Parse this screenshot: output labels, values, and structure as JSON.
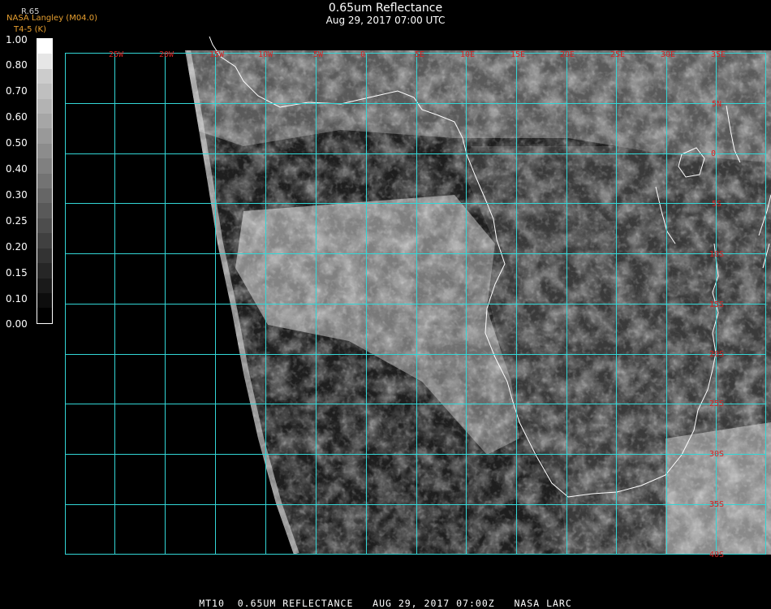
{
  "header": {
    "title": "0.65um Reflectance",
    "subtitle": "Aug 29, 2017 07:00 UTC"
  },
  "colorbar": {
    "top_label": "R.65",
    "agency": "NASA Langley (M04.0)",
    "sub_label": "T4-5 (K)",
    "ticks": [
      "1.00",
      "0.80",
      "0.70",
      "0.60",
      "0.50",
      "0.40",
      "0.30",
      "0.25",
      "0.20",
      "0.15",
      "0.10",
      "0.00"
    ],
    "levels": [
      1.0,
      0.9,
      0.8,
      0.75,
      0.7,
      0.65,
      0.6,
      0.55,
      0.5,
      0.45,
      0.4,
      0.35,
      0.3,
      0.25,
      0.2,
      0.15,
      0.1,
      0.05,
      0.0
    ]
  },
  "map": {
    "longitude_labels": [
      "25W",
      "20W",
      "15W",
      "10W",
      "5W",
      "0",
      "5E",
      "10E",
      "15E",
      "20E",
      "25E",
      "30E",
      "35E"
    ],
    "latitude_labels": [
      "5N",
      "0",
      "5S",
      "10S",
      "15S",
      "20S",
      "25S",
      "30S",
      "35S",
      "40S"
    ],
    "grid_color": "#33d6d6",
    "label_color": "#d62222",
    "coast_color": "#ffffff"
  },
  "footer": {
    "text": "MT10  0.65UM REFLECTANCE   AUG 29, 2017 07:00Z   NASA LARC"
  }
}
